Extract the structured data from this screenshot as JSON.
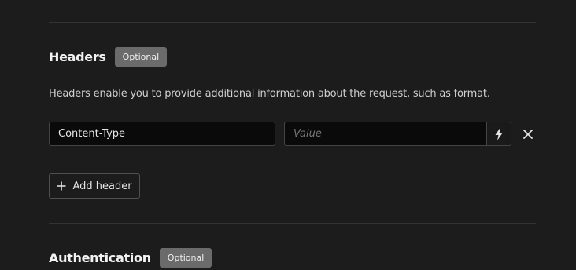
{
  "headers_section": {
    "title": "Headers",
    "badge": "Optional",
    "description": "Headers enable you to provide additional information about the request, such as format.",
    "rows": [
      {
        "key_value": "Content-Type",
        "value_placeholder": "Value",
        "value_value": ""
      }
    ],
    "add_button_label": "Add header"
  },
  "authentication_section": {
    "title": "Authentication",
    "badge": "Optional"
  },
  "icons": {
    "variable": "lightning-bolt-icon",
    "remove": "close-icon",
    "add": "plus-icon"
  },
  "colors": {
    "background": "#1c1c1c",
    "badge": "#6b6b6b",
    "input_background": "#0a0a0a",
    "border": "#444444"
  }
}
